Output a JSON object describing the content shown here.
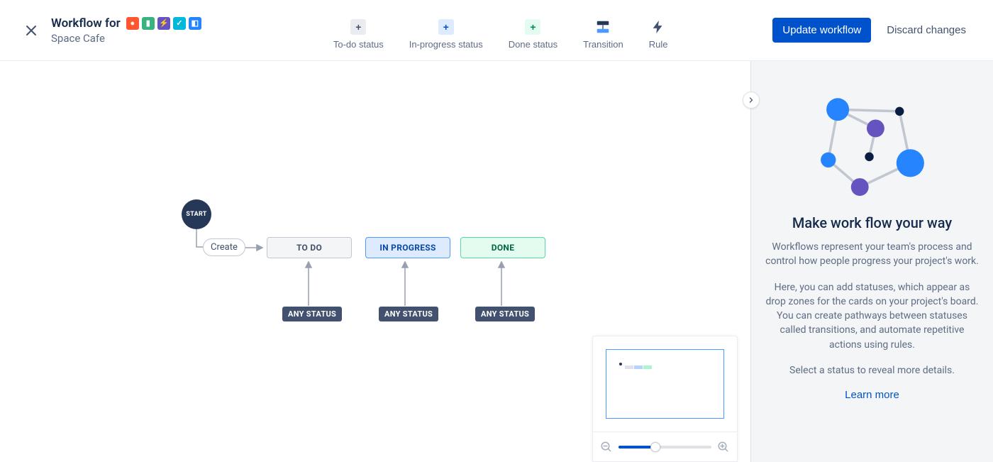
{
  "header": {
    "title_prefix": "Workflow for",
    "subtitle": "Space Cafe",
    "type_icons": [
      {
        "bg": "#FF5630",
        "glyph": "●"
      },
      {
        "bg": "#36B37E",
        "glyph": "▮"
      },
      {
        "bg": "#6554C0",
        "glyph": "⚡"
      },
      {
        "bg": "#00B8D9",
        "glyph": "✓"
      },
      {
        "bg": "#2684FF",
        "glyph": "◧"
      }
    ]
  },
  "toolbar": {
    "todo": {
      "label": "To-do status",
      "plus_bg": "#EBECF0",
      "plus_color": "#42526E"
    },
    "inprogress": {
      "label": "In-progress status",
      "plus_bg": "#DEEBFF",
      "plus_color": "#0052CC"
    },
    "done": {
      "label": "Done status",
      "plus_bg": "#E3FCEF",
      "plus_color": "#00875A"
    },
    "transition": {
      "label": "Transition"
    },
    "rule": {
      "label": "Rule"
    }
  },
  "actions": {
    "update": "Update workflow",
    "discard": "Discard changes"
  },
  "canvas": {
    "start": "START",
    "create": "Create",
    "todo": "TO DO",
    "inprogress": "IN PROGRESS",
    "done": "DONE",
    "any": "ANY STATUS"
  },
  "panel": {
    "title": "Make work flow your way",
    "p1": "Workflows represent your team's process and control how people progress your project's work.",
    "p2": "Here, you can add statuses, which appear as drop zones for the cards on your project's board. You can create pathways between statuses called transitions, and automate repetitive actions using rules.",
    "p3": "Select a status to reveal more details.",
    "learn": "Learn more"
  }
}
